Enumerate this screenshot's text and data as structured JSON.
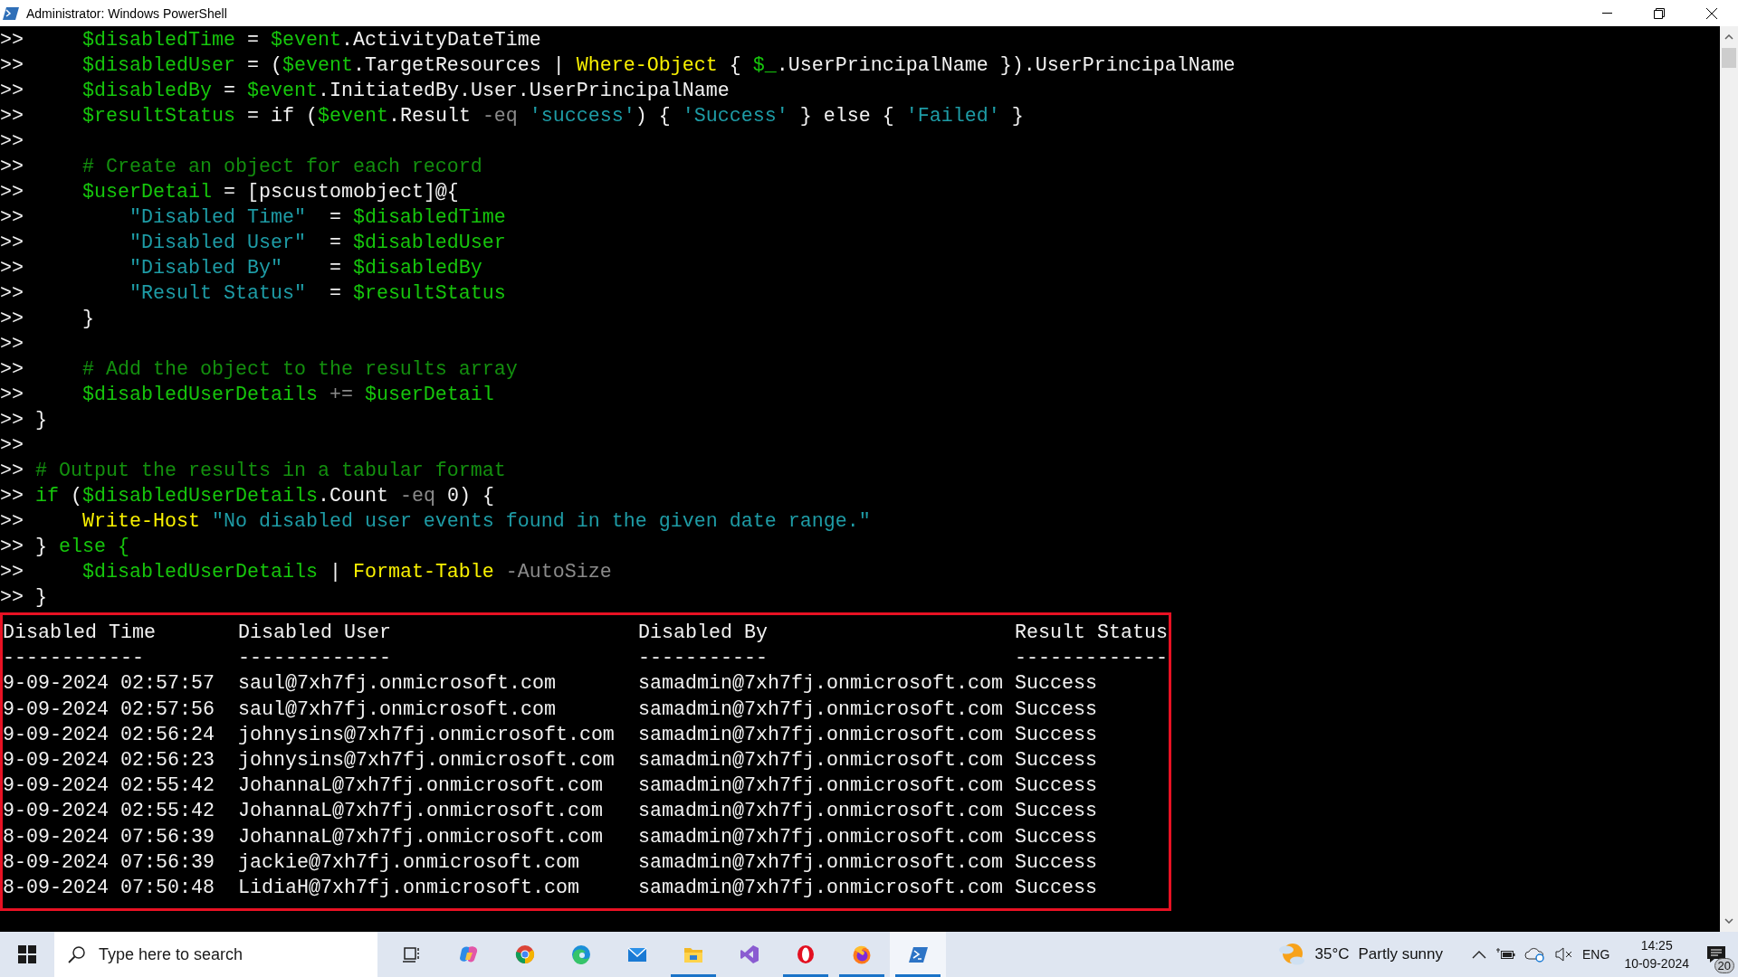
{
  "window": {
    "title": "Administrator: Windows PowerShell"
  },
  "console": {
    "lines": [
      {
        "prompt": ">>",
        "segments": [
          {
            "kind": "variable",
            "text": "    $disabledTime"
          },
          {
            "kind": "plain",
            "text": " = "
          },
          {
            "kind": "variable",
            "text": "$event"
          },
          {
            "kind": "plain",
            "text": ".ActivityDateTime"
          }
        ]
      },
      {
        "prompt": ">>",
        "segments": [
          {
            "kind": "variable",
            "text": "    $disabledUser"
          },
          {
            "kind": "plain",
            "text": " = ("
          },
          {
            "kind": "variable",
            "text": "$event"
          },
          {
            "kind": "plain",
            "text": ".TargetResources | "
          },
          {
            "kind": "command",
            "text": "Where-Object"
          },
          {
            "kind": "plain",
            "text": " { "
          },
          {
            "kind": "variable",
            "text": "$_"
          },
          {
            "kind": "plain",
            "text": ".UserPrincipalName }).UserPrincipalName"
          }
        ]
      },
      {
        "prompt": ">>",
        "segments": [
          {
            "kind": "variable",
            "text": "    $disabledBy"
          },
          {
            "kind": "plain",
            "text": " = "
          },
          {
            "kind": "variable",
            "text": "$event"
          },
          {
            "kind": "plain",
            "text": ".InitiatedBy.User.UserPrincipalName"
          }
        ]
      },
      {
        "prompt": ">>",
        "segments": [
          {
            "kind": "variable",
            "text": "    $resultStatus"
          },
          {
            "kind": "plain",
            "text": " = if ("
          },
          {
            "kind": "variable",
            "text": "$event"
          },
          {
            "kind": "plain",
            "text": ".Result "
          },
          {
            "kind": "operator",
            "text": "-eq"
          },
          {
            "kind": "string",
            "text": " 'success'"
          },
          {
            "kind": "plain",
            "text": ") { "
          },
          {
            "kind": "string",
            "text": "'Success'"
          },
          {
            "kind": "plain",
            "text": " } else { "
          },
          {
            "kind": "string",
            "text": "'Failed'"
          },
          {
            "kind": "plain",
            "text": " }"
          }
        ]
      },
      {
        "prompt": ">>"
      },
      {
        "prompt": ">>",
        "segments": [
          {
            "kind": "comment",
            "text": "    # Create an object for each record"
          }
        ]
      },
      {
        "prompt": ">>",
        "segments": [
          {
            "kind": "variable",
            "text": "    $userDetail"
          },
          {
            "kind": "plain",
            "text": " = [pscustomobject]@{"
          }
        ]
      },
      {
        "prompt": ">>",
        "segments": [
          {
            "kind": "string",
            "text": "        \"Disabled Time\""
          },
          {
            "kind": "plain",
            "text": "  = "
          },
          {
            "kind": "variable",
            "text": "$disabledTime"
          }
        ]
      },
      {
        "prompt": ">>",
        "segments": [
          {
            "kind": "string",
            "text": "        \"Disabled User\""
          },
          {
            "kind": "plain",
            "text": "  = "
          },
          {
            "kind": "variable",
            "text": "$disabledUser"
          }
        ]
      },
      {
        "prompt": ">>",
        "segments": [
          {
            "kind": "string",
            "text": "        \"Disabled By\""
          },
          {
            "kind": "plain",
            "text": "    = "
          },
          {
            "kind": "variable",
            "text": "$disabledBy"
          }
        ]
      },
      {
        "prompt": ">>",
        "segments": [
          {
            "kind": "string",
            "text": "        \"Result Status\""
          },
          {
            "kind": "plain",
            "text": "  = "
          },
          {
            "kind": "variable",
            "text": "$resultStatus"
          }
        ]
      },
      {
        "prompt": ">>",
        "segments": [
          {
            "kind": "plain",
            "text": "    }"
          }
        ]
      },
      {
        "prompt": ">>"
      },
      {
        "prompt": ">>",
        "segments": [
          {
            "kind": "comment",
            "text": "    # Add the object to the results array"
          }
        ]
      },
      {
        "prompt": ">>",
        "segments": [
          {
            "kind": "variable",
            "text": "    $disabledUserDetails"
          },
          {
            "kind": "operator",
            "text": " += "
          },
          {
            "kind": "variable",
            "text": "$userDetail"
          }
        ]
      },
      {
        "prompt": ">>",
        "segments": [
          {
            "kind": "plain",
            "text": "}"
          }
        ]
      },
      {
        "prompt": ">>"
      },
      {
        "prompt": ">>",
        "segments": [
          {
            "kind": "comment",
            "text": "# Output the results in a tabular format"
          }
        ]
      },
      {
        "prompt": ">>",
        "segments": [
          {
            "kind": "keyword",
            "text": "if"
          },
          {
            "kind": "plain",
            "text": " ("
          },
          {
            "kind": "variable",
            "text": "$disabledUserDetails"
          },
          {
            "kind": "plain",
            "text": ".Count "
          },
          {
            "kind": "operator",
            "text": "-eq"
          },
          {
            "kind": "plain",
            "text": " 0) {"
          }
        ]
      },
      {
        "prompt": ">>",
        "segments": [
          {
            "kind": "command",
            "text": "    Write-Host"
          },
          {
            "kind": "string",
            "text": " \"No disabled user events found in the given date range.\""
          }
        ]
      },
      {
        "prompt": ">>",
        "segments": [
          {
            "kind": "plain",
            "text": "} "
          },
          {
            "kind": "keyword",
            "text": "else {"
          }
        ]
      },
      {
        "prompt": ">>",
        "segments": [
          {
            "kind": "variable",
            "text": "    $disabledUserDetails"
          },
          {
            "kind": "plain",
            "text": " | "
          },
          {
            "kind": "command",
            "text": "Format-Table"
          },
          {
            "kind": "operator",
            "text": " -AutoSize"
          }
        ]
      },
      {
        "prompt": ">>",
        "segments": [
          {
            "kind": "plain",
            "text": "}"
          }
        ]
      }
    ]
  },
  "output_table": {
    "columns": [
      {
        "header": "Disabled Time",
        "rule": "------------"
      },
      {
        "header": "Disabled User",
        "rule": "-------------"
      },
      {
        "header": "Disabled By",
        "rule": "-----------"
      },
      {
        "header": "Result Status",
        "rule": "-------------"
      }
    ],
    "rows": [
      [
        "9-09-2024 02:57:57",
        "saul@7xh7fj.onmicrosoft.com",
        "samadmin@7xh7fj.onmicrosoft.com",
        "Success"
      ],
      [
        "9-09-2024 02:57:56",
        "saul@7xh7fj.onmicrosoft.com",
        "samadmin@7xh7fj.onmicrosoft.com",
        "Success"
      ],
      [
        "9-09-2024 02:56:24",
        "johnysins@7xh7fj.onmicrosoft.com",
        "samadmin@7xh7fj.onmicrosoft.com",
        "Success"
      ],
      [
        "9-09-2024 02:56:23",
        "johnysins@7xh7fj.onmicrosoft.com",
        "samadmin@7xh7fj.onmicrosoft.com",
        "Success"
      ],
      [
        "9-09-2024 02:55:42",
        "JohannaL@7xh7fj.onmicrosoft.com",
        "samadmin@7xh7fj.onmicrosoft.com",
        "Success"
      ],
      [
        "9-09-2024 02:55:42",
        "JohannaL@7xh7fj.onmicrosoft.com",
        "samadmin@7xh7fj.onmicrosoft.com",
        "Success"
      ],
      [
        "8-09-2024 07:56:39",
        "JohannaL@7xh7fj.onmicrosoft.com",
        "samadmin@7xh7fj.onmicrosoft.com",
        "Success"
      ],
      [
        "8-09-2024 07:56:39",
        "jackie@7xh7fj.onmicrosoft.com",
        "samadmin@7xh7fj.onmicrosoft.com",
        "Success"
      ],
      [
        "8-09-2024 07:50:48",
        "LidiaH@7xh7fj.onmicrosoft.com",
        "samadmin@7xh7fj.onmicrosoft.com",
        "Success"
      ]
    ]
  },
  "taskbar": {
    "search": {
      "placeholder": "Type here to search"
    },
    "apps": [
      {
        "kind": "taskview",
        "running": false,
        "selected": false
      },
      {
        "kind": "copilot",
        "running": false,
        "selected": false
      },
      {
        "kind": "chrome",
        "running": false,
        "selected": false
      },
      {
        "kind": "edge",
        "running": false,
        "selected": false
      },
      {
        "kind": "mail",
        "running": false,
        "selected": false
      },
      {
        "kind": "explorer",
        "running": true,
        "selected": false
      },
      {
        "kind": "studio",
        "running": false,
        "selected": false
      },
      {
        "kind": "opera",
        "running": true,
        "selected": false
      },
      {
        "kind": "firefox",
        "running": true,
        "selected": false
      },
      {
        "kind": "powershell",
        "running": true,
        "selected": true
      }
    ],
    "weather": {
      "temperature": "35°C",
      "condition": "Partly sunny"
    },
    "language": "ENG",
    "time": "14:25",
    "date": "10-09-2024",
    "notification_count": "20"
  }
}
